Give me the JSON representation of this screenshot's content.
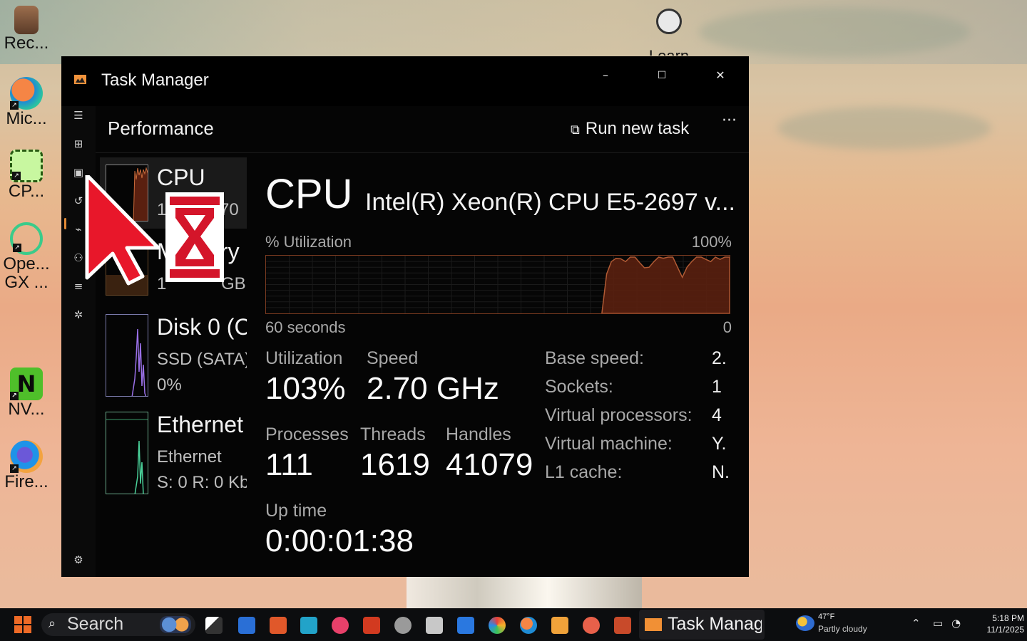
{
  "desktop": {
    "icons": [
      {
        "label": "Rec...",
        "icon": "recycle-bin-icon"
      },
      {
        "label": "Mic...",
        "icon": "edge-icon"
      },
      {
        "label": "CP...",
        "icon": "cpu-z-icon"
      },
      {
        "label": "Ope...",
        "icon": "opera-gx-icon"
      },
      {
        "label": "GX ...",
        "icon": "opera-gx-icon"
      },
      {
        "label": "NV...",
        "icon": "nvidia-icon"
      },
      {
        "label": "Fire...",
        "icon": "firefox-icon"
      }
    ],
    "learn_label": "Learn"
  },
  "window": {
    "title": "Task Manager",
    "caption": {
      "minimize": "–",
      "maximize": "☐",
      "close": "✕"
    }
  },
  "header": {
    "page_title": "Performance",
    "run_new_task": "Run new task",
    "more": "···"
  },
  "perf_list": [
    {
      "name": "CPU",
      "sub1": "1",
      "sub1_tail": "70"
    },
    {
      "name": "Memory",
      "sub1": "1",
      "sub1_tail": "GB"
    },
    {
      "name": "Disk 0 (C",
      "sub1": "SSD (SATA)",
      "sub2": "0%"
    },
    {
      "name": "Ethernet",
      "sub1": "Ethernet",
      "sub2": "S: 0 R: 0 Kb"
    }
  ],
  "details": {
    "title": "CPU",
    "model": "Intel(R) Xeon(R) CPU E5-2697 v...",
    "util_label": "% Utilization",
    "util_max": "100%",
    "time_span": "60 seconds",
    "time_min": "0",
    "graph_values": [
      0,
      0,
      0,
      0,
      0,
      0,
      0,
      0,
      0,
      0,
      0,
      0,
      0,
      0,
      0,
      0,
      0,
      0,
      0,
      0,
      0,
      0,
      0,
      0,
      0,
      0,
      0,
      0,
      0,
      0,
      0,
      0,
      0,
      0,
      0,
      0,
      0,
      0,
      0,
      0,
      0,
      0,
      0,
      0,
      0,
      0,
      0,
      0,
      0,
      0,
      0,
      0,
      0,
      0,
      0,
      0,
      0,
      0,
      0,
      0,
      0,
      0,
      0,
      0,
      0,
      0,
      0,
      0,
      0,
      0,
      0,
      0,
      70,
      92,
      98,
      97,
      92,
      100,
      100,
      90,
      81,
      82,
      92,
      100,
      98,
      100,
      100,
      82,
      64,
      82,
      92,
      100,
      100,
      96,
      92,
      100,
      96,
      100,
      100
    ],
    "utilization_label": "Utilization",
    "utilization": "103%",
    "speed_label": "Speed",
    "speed": "2.70 GHz",
    "processes_label": "Processes",
    "processes": "111",
    "threads_label": "Threads",
    "threads": "1619",
    "handles_label": "Handles",
    "handles": "41079",
    "uptime_label": "Up time",
    "uptime": "0:00:01:38",
    "specs": [
      {
        "key": "Base speed:",
        "value": "2."
      },
      {
        "key": "Sockets:",
        "value": "1"
      },
      {
        "key": "Virtual processors:",
        "value": "4"
      },
      {
        "key": "Virtual machine:",
        "value": "Y."
      },
      {
        "key": "L1 cache:",
        "value": "N."
      }
    ]
  },
  "taskbar": {
    "search_placeholder": "Search",
    "active_app": "Task Manager",
    "weather_temp": "47°F",
    "weather_desc": "Partly cloudy",
    "time": "5:18 PM",
    "date": "11/1/2025"
  },
  "colors": {
    "accent": "#e48a35",
    "graph_fill": "#5a2010",
    "graph_line": "#b05a34",
    "window_bg": "#000000"
  }
}
